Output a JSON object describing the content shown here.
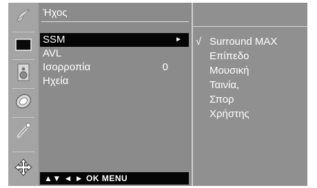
{
  "icons": [
    {
      "name": "picture-icon"
    },
    {
      "name": "screen-icon"
    },
    {
      "name": "speaker-icon"
    },
    {
      "name": "time-icon"
    },
    {
      "name": "option-icon"
    },
    {
      "name": "input-icon"
    }
  ],
  "menu": {
    "title": "Ήχος",
    "items": [
      {
        "label": "SSM",
        "value": "",
        "arrow": "►",
        "selected": true
      },
      {
        "label": "AVL",
        "value": "",
        "arrow": "",
        "selected": false
      },
      {
        "label": "Ισορροπία",
        "value": "0",
        "arrow": "",
        "selected": false
      },
      {
        "label": "Ηχεία",
        "value": "",
        "arrow": "",
        "selected": false
      }
    ],
    "hint": "▲▼  ◄ ►  OK  MENU"
  },
  "submenu": {
    "check_mark": "√",
    "items": [
      {
        "label": "Surround MAX",
        "checked": true
      },
      {
        "label": "Επίπεδο",
        "checked": false
      },
      {
        "label": "Μουσική",
        "checked": false
      },
      {
        "label": "Ταινία,",
        "checked": false
      },
      {
        "label": "Σπορ",
        "checked": false
      },
      {
        "label": "Χρήστης",
        "checked": false
      }
    ]
  },
  "colors": {
    "selection": "#050505",
    "panel": "#8b8b8b",
    "icon_column": "#a4a4a4"
  }
}
